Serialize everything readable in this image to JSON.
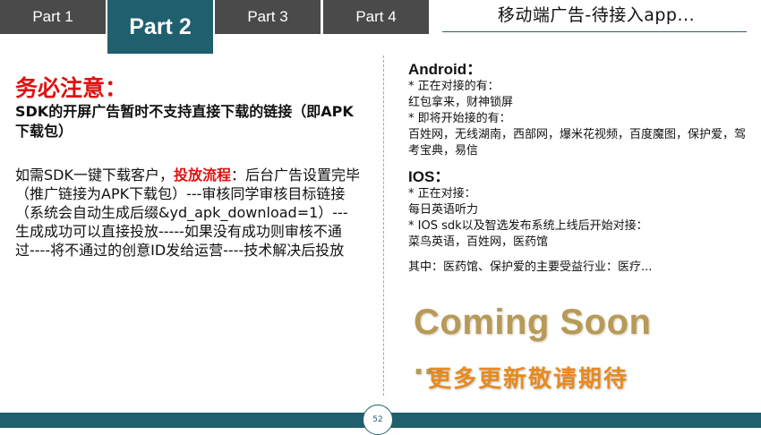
{
  "tabs": [
    {
      "label": "Part 1",
      "active": false
    },
    {
      "label": "Part 2",
      "active": true
    },
    {
      "label": "Part 3",
      "active": false
    },
    {
      "label": "Part 4",
      "active": false
    }
  ],
  "header": {
    "title": "移动端广告-待接入app..."
  },
  "left": {
    "warning_title": "务必注意：",
    "warning_body": "SDK的开屏广告暂时不支持直接下载的链接（即APK下载包）",
    "para_prefix": "如需SDK一键下载客户，",
    "para_highlight": "投放流程",
    "para_suffix": "：后台广告设置完毕（推广链接为APK下载包）---审核同学审核目标链接（系统会自动生成后缀&yd_apk_download=1）---生成成功可以直接投放-----如果没有成功则审核不通过----将不通过的创意ID发给运营----技术解决后投放"
  },
  "right": {
    "android": {
      "title": "Android：",
      "lines": [
        "* 正在对接的有：",
        "红包拿来，财神锁屏",
        "* 即将开始接的有：",
        "百姓网，无线湖南，西部网，爆米花视频，百度魔图，保护爱，驾考宝典，易信"
      ]
    },
    "ios": {
      "title": "IOS：",
      "lines": [
        "* 正在对接：",
        "每日英语听力",
        "* IOS sdk以及智选发布系统上线后开始对接：",
        "菜鸟英语，百姓网，医药馆"
      ]
    },
    "note": "其中：医药馆、保护爱的主要受益行业：医疗..."
  },
  "coming_soon": "Coming Soon ...",
  "more_updates": "更多更新敬请期待",
  "page_number": "52",
  "colors": {
    "accent": "#1f5f6e",
    "tab": "#4a4a4a",
    "warning": "#e01010",
    "gold": "#b79a57",
    "orange": "#e88a1e"
  }
}
